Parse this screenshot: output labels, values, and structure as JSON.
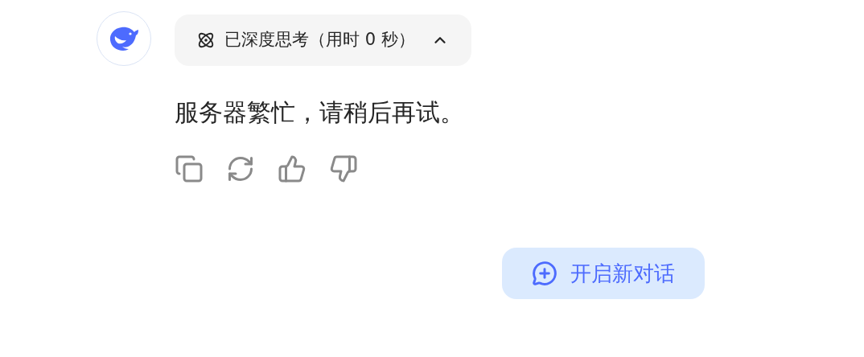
{
  "thinking": {
    "label": "已深度思考（用时 0 秒）",
    "expanded": true
  },
  "message": "服务器繁忙，请稍后再试。",
  "new_chat_button": "开启新对话"
}
